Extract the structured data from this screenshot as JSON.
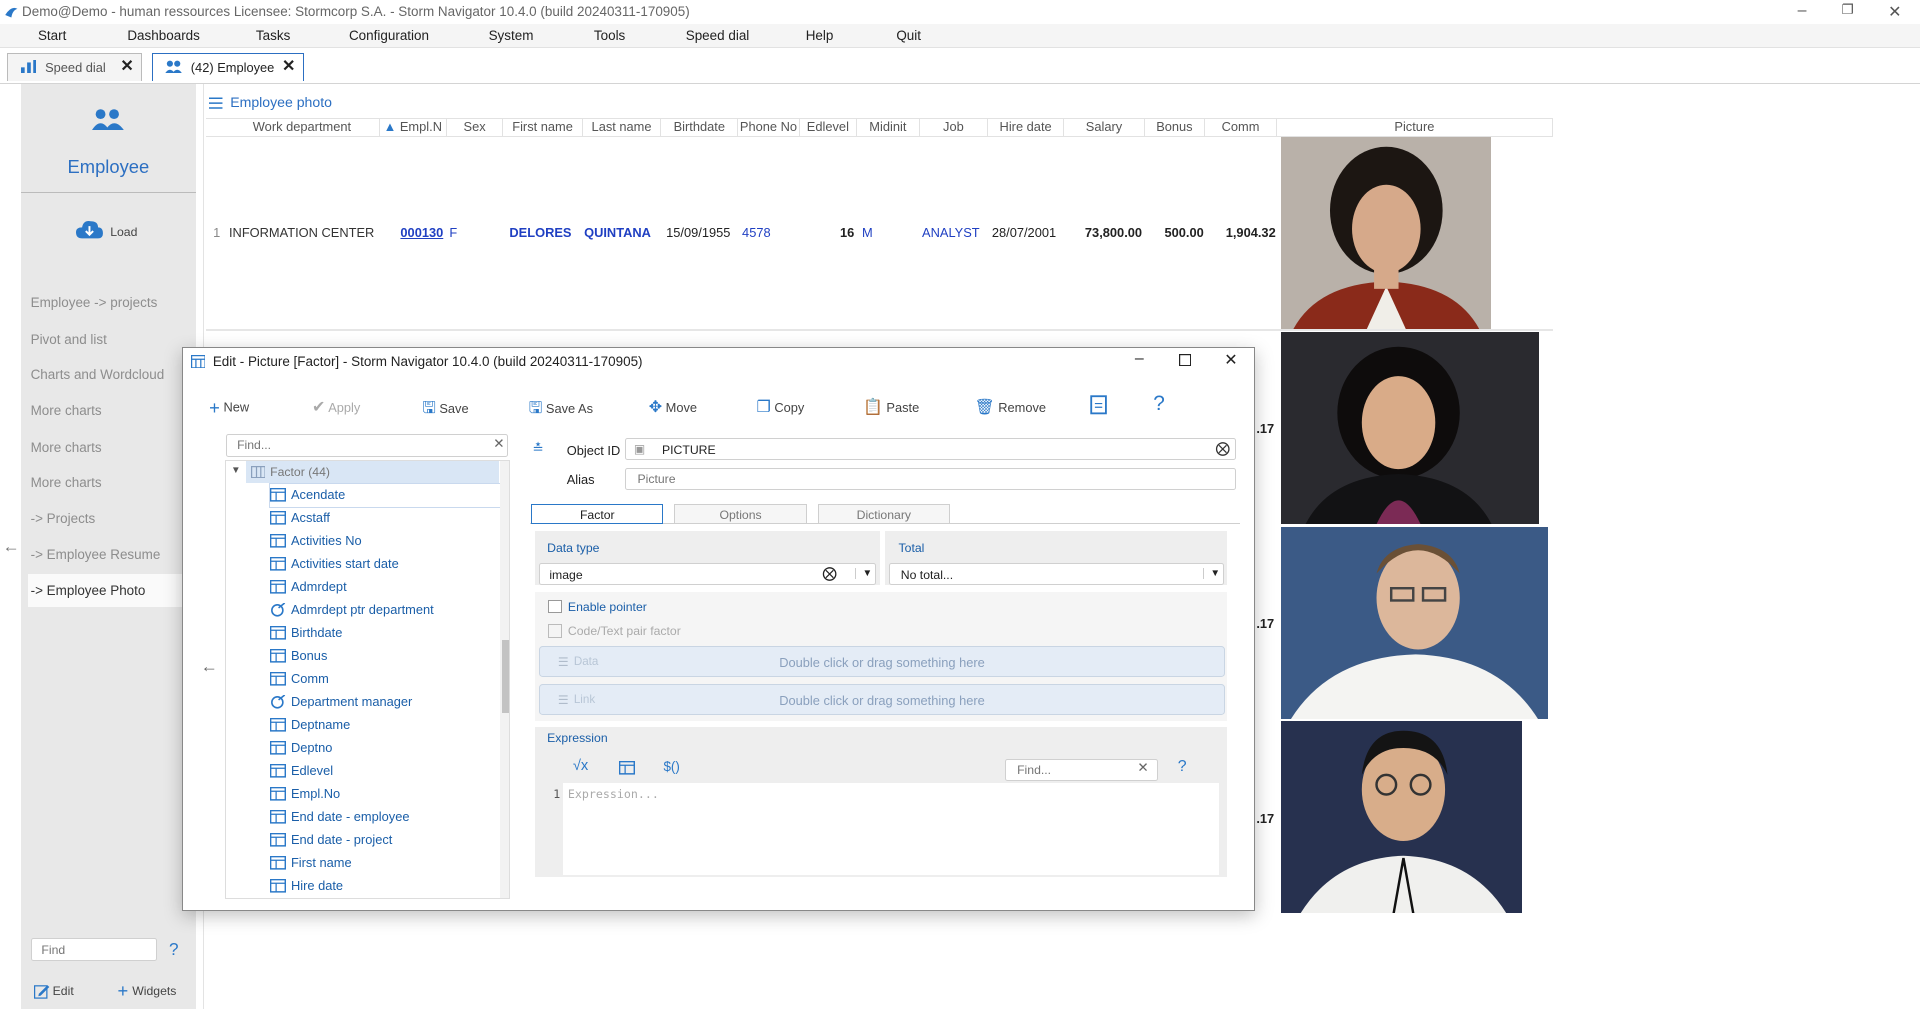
{
  "app": {
    "title": "Demo@Demo - human ressources   Licensee: Stormcorp S.A. -  Storm Navigator 10.4.0 (build 20240311-170905)"
  },
  "menu": [
    "Start",
    "Dashboards",
    "Tasks",
    "Configuration",
    "System",
    "Tools",
    "Speed dial",
    "Help",
    "Quit"
  ],
  "tabs": [
    {
      "label": "Speed dial"
    },
    {
      "label": "(42) Employee"
    }
  ],
  "sidebar": {
    "title": "Employee",
    "load": "Load",
    "items": [
      "Employee -> projects",
      "Pivot and list",
      "Charts and Wordcloud",
      "More charts",
      "More charts",
      "More charts",
      "-> Projects",
      "-> Employee Resume",
      "-> Employee Photo"
    ],
    "find_placeholder": "Find",
    "help": "?",
    "edit": "Edit",
    "widgets": "Widgets"
  },
  "grid": {
    "title": "Employee photo",
    "columns": [
      "Work department",
      "Empl.N",
      "Sex",
      "First name",
      "Last name",
      "Birthdate",
      "Phone No",
      "Edlevel",
      "Midinit",
      "Job",
      "Hire date",
      "Salary",
      "Bonus",
      "Comm",
      "Picture"
    ],
    "row": {
      "num": "1",
      "dept": "INFORMATION CENTER",
      "empl": "000130",
      "sex": "F",
      "first": "DELORES",
      "last": "QUINTANA",
      "birth": "15/09/1955",
      "phone": "4578",
      "edlevel": "16",
      "midinit": "M",
      "job": "ANALYST",
      "hire": "28/07/2001",
      "salary": "73,800.00",
      "bonus": "500.00",
      "comm": "1,904.32"
    },
    "partial": [
      ".17",
      ".17",
      ".17"
    ]
  },
  "dialog": {
    "title": "Edit - Picture [Factor] -  Storm Navigator 10.4.0 (build 20240311-170905)",
    "toolbar": [
      "New",
      "Apply",
      "Save",
      "Save As",
      "Move",
      "Copy",
      "Paste",
      "Remove"
    ],
    "find_placeholder": "Find...",
    "tree_root": "Factor (44)",
    "tree": [
      "Acendate",
      "Acstaff",
      "Activities No",
      "Activities start date",
      "Admrdept",
      "Admrdept ptr department",
      "Birthdate",
      "Bonus",
      "Comm",
      "Department manager",
      "Deptname",
      "Deptno",
      "Edlevel",
      "Empl.No",
      "End date - employee",
      "End date - project",
      "First name",
      "Hire date"
    ],
    "object_id_label": "Object ID",
    "object_id": "PICTURE",
    "alias_label": "Alias",
    "alias_placeholder": "Picture",
    "tabs": [
      "Factor",
      "Options",
      "Dictionary"
    ],
    "data_type_label": "Data type",
    "data_type": "image",
    "total_label": "Total",
    "total": "No total...",
    "enable_pointer": "Enable pointer",
    "code_text_pair": "Code/Text pair factor",
    "data_label": "Data",
    "link_label": "Link",
    "drop_hint": "Double click or drag something here",
    "expression_label": "Expression",
    "expr_line": "1",
    "expr_placeholder": "Expression...",
    "expr_find": "Find...",
    "help": "?"
  }
}
